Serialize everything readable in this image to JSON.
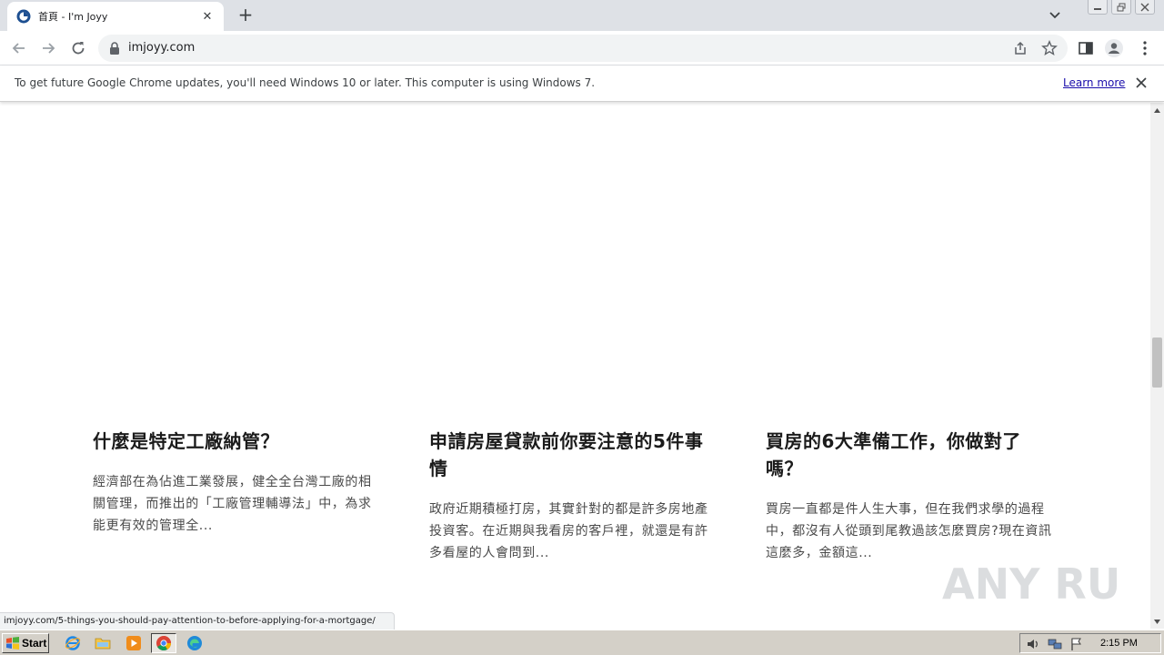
{
  "browser": {
    "tab": {
      "title": "首頁 - I'm Joyy"
    },
    "address": {
      "url": "imjoyy.com"
    },
    "infobar": {
      "message": "To get future Google Chrome updates, you'll need Windows 10 or later. This computer is using Windows 7.",
      "link_label": "Learn more"
    },
    "status_url": "imjoyy.com/5-things-you-should-pay-attention-to-before-applying-for-a-mortgage/"
  },
  "posts": [
    {
      "title": "什麼是特定工廠納管？",
      "excerpt": "經濟部在為佔進工業發展，健全全台灣工廠的相關管理，而推出的「工廠管理輔導法」中，為求能更有效的管理全..."
    },
    {
      "title": "申請房屋貸款前你要注意的5件事情",
      "excerpt": "政府近期積極打房，其實針對的都是許多房地產投資客。在近期與我看房的客戶裡，就還是有許多看屋的人會問到..."
    },
    {
      "title": "買房的6大準備工作，你做對了嗎？",
      "excerpt": "買房一直都是件人生大事，但在我們求學的過程中，都沒有人從頭到尾教過該怎麼買房?現在資訊這麼多，金額這..."
    }
  ],
  "watermark": {
    "text": "ANY RUN"
  },
  "taskbar": {
    "start_label": "Start",
    "clock": "2:15 PM",
    "apps": [
      "internet-explorer",
      "file-explorer",
      "media-player",
      "chrome",
      "edge"
    ]
  }
}
